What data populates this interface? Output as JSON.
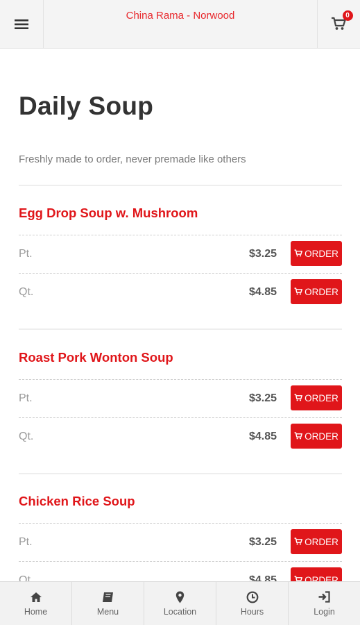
{
  "header": {
    "title": "China Rama - Norwood",
    "cart_count": "0",
    "menu_icon": "hamburger-icon",
    "cart_icon": "cart-icon"
  },
  "page": {
    "title": "Daily Soup",
    "subtitle": "Freshly made to order, never premade like others"
  },
  "colors": {
    "accent": "#e0161a",
    "title_text": "#333333",
    "muted_text": "#7a7a7a"
  },
  "order_label": "ORDER",
  "items": [
    {
      "name": "Egg Drop Soup w. Mushroom",
      "options": [
        {
          "size": "Pt.",
          "price": "$3.25"
        },
        {
          "size": "Qt.",
          "price": "$4.85"
        }
      ]
    },
    {
      "name": "Roast Pork Wonton Soup",
      "options": [
        {
          "size": "Pt.",
          "price": "$3.25"
        },
        {
          "size": "Qt.",
          "price": "$4.85"
        }
      ]
    },
    {
      "name": "Chicken Rice Soup",
      "options": [
        {
          "size": "Pt.",
          "price": "$3.25"
        },
        {
          "size": "Qt.",
          "price": "$4.85"
        }
      ]
    }
  ],
  "nav": [
    {
      "label": "Home",
      "icon": "home-icon"
    },
    {
      "label": "Menu",
      "icon": "book-icon"
    },
    {
      "label": "Location",
      "icon": "map-pin-icon"
    },
    {
      "label": "Hours",
      "icon": "clock-icon"
    },
    {
      "label": "Login",
      "icon": "login-icon"
    }
  ]
}
